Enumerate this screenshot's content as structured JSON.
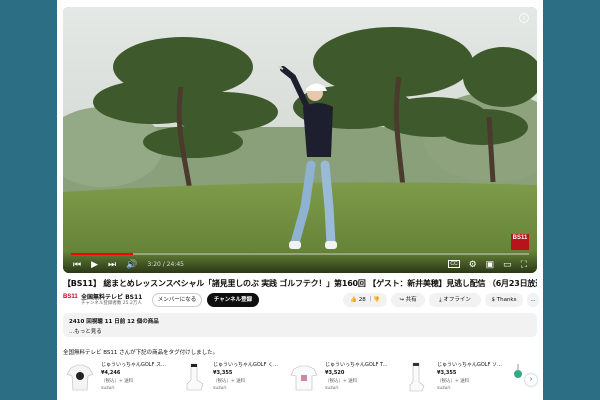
{
  "player": {
    "time": "3:20 / 24:45",
    "progress_fraction": 0.135,
    "badge": "BS11",
    "info_icon": "i"
  },
  "video": {
    "title": "【BS11】 総まとめレッスンスペシャル「諸見里しのぶ 実践 ゴルフテク！」第160回 【ゲスト：新井美穂】見逃し配信 （6月23日放送分）"
  },
  "channel": {
    "logo_text": "BS11",
    "name": "全国無料テレビ BS11",
    "subscribers": "チャンネル登録者数 25.2万人",
    "member_label": "メンバーになる",
    "subscribe_label": "チャンネル登録"
  },
  "actions": {
    "like_count": "28",
    "share_label": "共有",
    "offline_label": "オフライン",
    "thanks_label": "Thanks",
    "more_label": "..."
  },
  "description": {
    "stats": "2410 回視聴  11 日前  12 個の商品",
    "more": "...もっと見る"
  },
  "shopping": {
    "header": "全国無料テレビ BS11 さんが下記の商品をタグ付けしました。",
    "products": [
      {
        "name": "じゅういっちゃんGOLF ス...",
        "price": "¥4,246",
        "tax": "（税込）+ 送料",
        "store": "suzuri"
      },
      {
        "name": "じゅういっちゃんGOLF く...",
        "price": "¥3,355",
        "tax": "（税込）+ 送料",
        "store": "suzuri"
      },
      {
        "name": "じゅういっちゃんGOLF T...",
        "price": "¥3,520",
        "tax": "（税込）+ 送料",
        "store": "suzuri"
      },
      {
        "name": "じゅういっちゃんGOLF ソ...",
        "price": "¥3,355",
        "tax": "（税込）+ 送料",
        "store": "suzuri"
      }
    ]
  },
  "colors": {
    "background": "#2c6f84",
    "accent_red": "#ff0000",
    "subscribe_bg": "#0f0f0f"
  }
}
